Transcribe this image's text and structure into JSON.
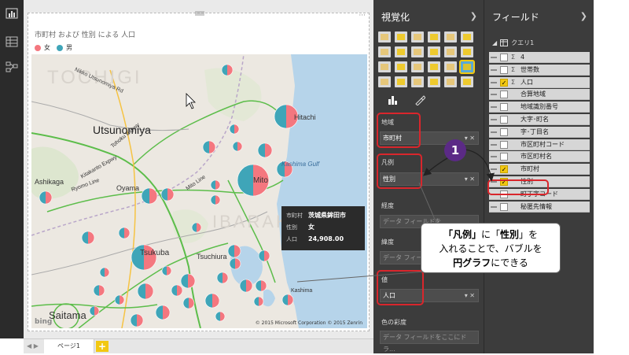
{
  "report": {
    "visual_title": "市町村 および 性別 による 人口",
    "legend": [
      {
        "label": "女",
        "color": "#f4777f"
      },
      {
        "label": "男",
        "color": "#3fa5b8"
      }
    ]
  },
  "map": {
    "labels": {
      "tochigi": "TOCHIGI",
      "nikko": "Nikko Utsunomiya Rd",
      "utsunomiya": "Utsunomiya",
      "hitachi": "Hitachi",
      "kashima_gulf": "Kashima Gulf",
      "ashikaga": "Ashikaga",
      "ryomo": "Ryomo Line",
      "oyama": "Oyama",
      "mito_line": "Mito Line",
      "mito": "Mito",
      "ibaraki": "IBARAKI",
      "tsukuba": "Tsukuba",
      "tsuchiura": "Tsuchiura",
      "kashima": "Kashima",
      "saitama": "Saitama",
      "tohoku_expwy": "Tohoku Expwy",
      "kitakanto": "Kitakanto Expwy"
    },
    "copyright": "© 2015 Microsoft Corporation   © 2015 Zenrin",
    "logo": "bing"
  },
  "tooltip": {
    "rows": [
      {
        "key": "市町村",
        "value": "茨城県鉾田市"
      },
      {
        "key": "性別",
        "value": "女"
      },
      {
        "key": "人口",
        "value": "24,908.00"
      }
    ]
  },
  "pages": {
    "tab_label": "ページ1",
    "add_label": "+"
  },
  "visualizations": {
    "title": "視覚化",
    "wells": {
      "location_label": "地域",
      "location_value": "市町村",
      "legend_label": "凡例",
      "legend_value": "性別",
      "latitude_label": "緯度",
      "latitude_placeholder": "データ フィールドを",
      "longitude_label": "経度",
      "longitude_placeholder": "データ フィールドを",
      "size_label": "値",
      "size_value": "人口",
      "saturation_label": "色の彩度",
      "saturation_placeholder": "データ フィールドをここにドラ..."
    }
  },
  "fields": {
    "title": "フィールド",
    "table_name": "クエリ1",
    "items": [
      {
        "name": "4",
        "sigma": "Σ",
        "checked": false
      },
      {
        "name": "世帯数",
        "sigma": "Σ",
        "checked": false
      },
      {
        "name": "人口",
        "sigma": "Σ",
        "checked": true
      },
      {
        "name": "合算地域",
        "sigma": "",
        "checked": false
      },
      {
        "name": "地域識別番号",
        "sigma": "",
        "checked": false
      },
      {
        "name": "大字･町名",
        "sigma": "",
        "checked": false
      },
      {
        "name": "字･丁目名",
        "sigma": "",
        "checked": false
      },
      {
        "name": "市区町村コード",
        "sigma": "",
        "checked": false
      },
      {
        "name": "市区町村名",
        "sigma": "",
        "checked": false
      },
      {
        "name": "市町村",
        "sigma": "",
        "checked": true
      },
      {
        "name": "性別",
        "sigma": "",
        "checked": true
      },
      {
        "name": "町丁字コード",
        "sigma": "",
        "checked": false
      },
      {
        "name": "秘匿先情報",
        "sigma": "",
        "checked": false
      }
    ]
  },
  "annotation": {
    "badge": "1",
    "callout_line1a": "「凡例」",
    "callout_line1b": "に「",
    "callout_line1c": "性別",
    "callout_line1d": "」を",
    "callout_line2": "入れることで、バブルを",
    "callout_line3a": "円グラフ",
    "callout_line3b": "にできる"
  }
}
